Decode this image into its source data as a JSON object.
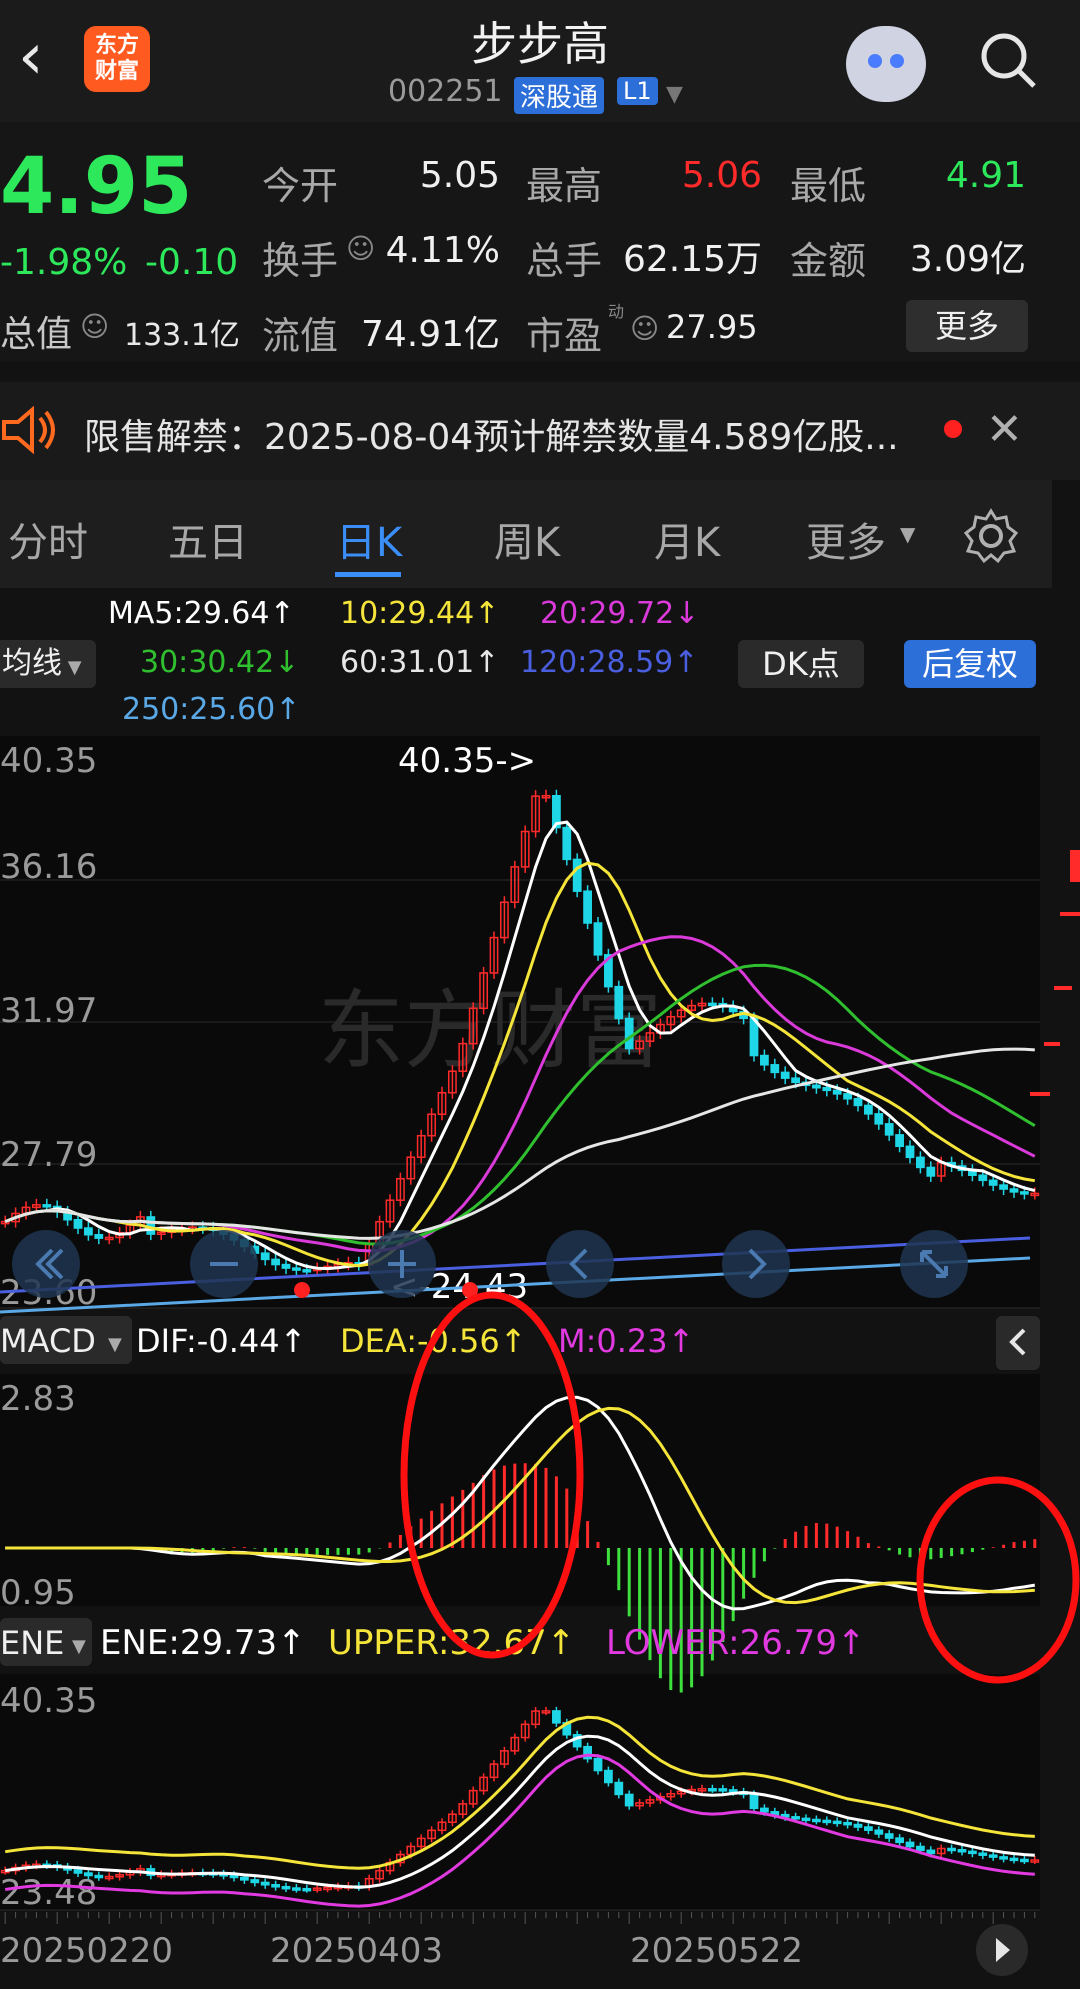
{
  "header": {
    "title": "步步高",
    "logo_text": "东方财富",
    "code": "002251",
    "tag_connect": "深股通",
    "tag_level": "L1"
  },
  "quote": {
    "price": "4.95",
    "change_pct": "-1.98%",
    "change_abs": "-0.10",
    "total_value_label": "总值",
    "total_value": "133.1亿",
    "rows": [
      {
        "l1": "今开",
        "v1": "5.05",
        "l2": "最高",
        "v2": "5.06",
        "l3": "最低",
        "v3": "4.91"
      },
      {
        "l1": "换手",
        "v1": "4.11%",
        "l2": "总手",
        "v2": "62.15万",
        "l3": "金额",
        "v3": "3.09亿"
      },
      {
        "l1": "流值",
        "v1": "74.91亿",
        "l2": "市盈",
        "v2": "27.95"
      }
    ],
    "pe_superscript": "动",
    "more_label": "更多"
  },
  "notice": {
    "text": "限售解禁：2025-08-04预计解禁数量4.589亿股..."
  },
  "tabs": [
    {
      "label": "分时"
    },
    {
      "label": "五日"
    },
    {
      "label": "日K"
    },
    {
      "label": "周K"
    },
    {
      "label": "月K"
    },
    {
      "label": "更多"
    }
  ],
  "ma": {
    "selector": "均线",
    "ma5": "MA5:29.64↑",
    "ma10": "10:29.44↑",
    "ma20": "20:29.72↓",
    "ma30": "30:30.42↓",
    "ma60": "60:31.01↑",
    "ma120": "120:28.59↑",
    "ma250": "250:25.60↑",
    "dk_label": "DK点",
    "restore_label": "后复权",
    "colors": {
      "ma5": "#ffffff",
      "ma10": "#f5e53a",
      "ma20": "#d93ad9",
      "ma30": "#2fbf2f",
      "ma60": "#e6e6e6",
      "ma120": "#4a5fe0",
      "ma250": "#5aa8e6"
    }
  },
  "kchart": {
    "y_labels": [
      "40.35",
      "36.16",
      "31.97",
      "27.79",
      "23.60"
    ],
    "high_marker": "40.35->",
    "low_marker": "<-24.43"
  },
  "macd": {
    "selector": "MACD",
    "dif": "DIF:-0.44↑",
    "dea": "DEA:-0.56↑",
    "m": "M:0.23↑",
    "y_top": "2.83",
    "y_bottom": "0.95"
  },
  "ene": {
    "selector": "ENE",
    "ene": "ENE:29.73↑",
    "upper": "UPPER:32.67↑",
    "lower": "LOWER:26.79↑",
    "y_top": "40.35",
    "y_bottom": "23.48"
  },
  "x_axis": {
    "dates": [
      "20250220",
      "20250403",
      "20250522"
    ]
  },
  "chart_data": {
    "type": "line",
    "x": [
      "20250220",
      "20250403",
      "20250522"
    ],
    "ylim": [
      23.6,
      40.35
    ],
    "annotations": [
      "40.35->",
      "<-24.43"
    ],
    "series": [
      {
        "name": "MA5",
        "last": 29.64
      },
      {
        "name": "MA10",
        "last": 29.44
      },
      {
        "name": "MA20",
        "last": 29.72
      },
      {
        "name": "MA30",
        "last": 30.42
      },
      {
        "name": "MA60",
        "last": 31.01
      },
      {
        "name": "MA120",
        "last": 28.59
      },
      {
        "name": "MA250",
        "last": 25.6
      }
    ]
  }
}
